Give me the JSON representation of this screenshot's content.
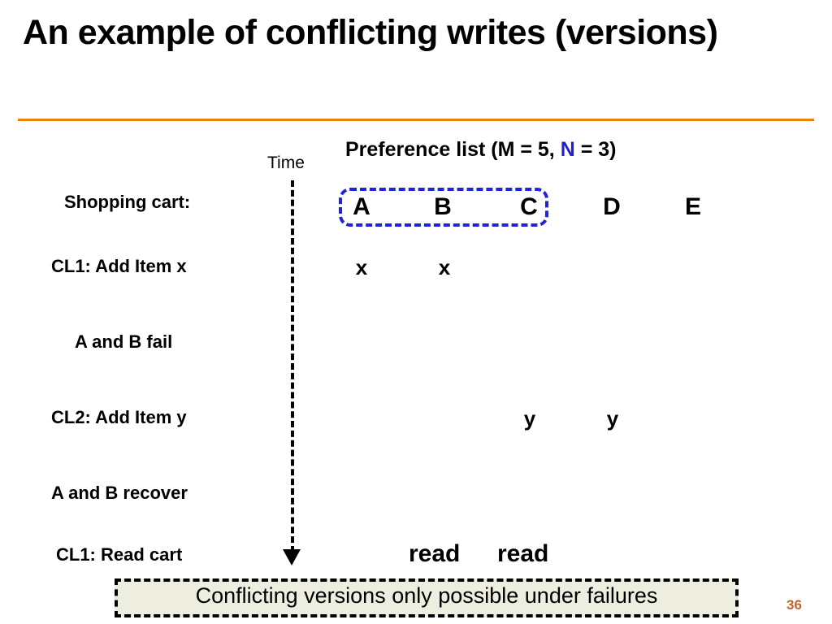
{
  "slide": {
    "title": "An example of conflicting writes (versions)",
    "page_number": "36",
    "accent_rule_color": "#E8820C",
    "highlight_border_color": "#2222DD",
    "page_number_color": "#C4622B"
  },
  "diagram": {
    "preference_list_heading": {
      "prefix": "Preference list (M = 5, ",
      "n_symbol": "N",
      "suffix": " = 3)"
    },
    "time_axis_label": "Time",
    "nodes": [
      "A",
      "B",
      "C",
      "D",
      "E"
    ],
    "row_labels": [
      "Shopping cart:",
      "CL1: Add Item x",
      "A and B fail",
      "CL2: Add Item y",
      "A and B recover",
      "CL1: Read cart"
    ],
    "writes": {
      "item_x": [
        "x",
        "x"
      ],
      "item_y": [
        "y",
        "y"
      ]
    },
    "reads": [
      "read",
      "read"
    ]
  },
  "footer": {
    "note": "Conflicting versions only possible under failures",
    "background": "#EDEEE0"
  }
}
